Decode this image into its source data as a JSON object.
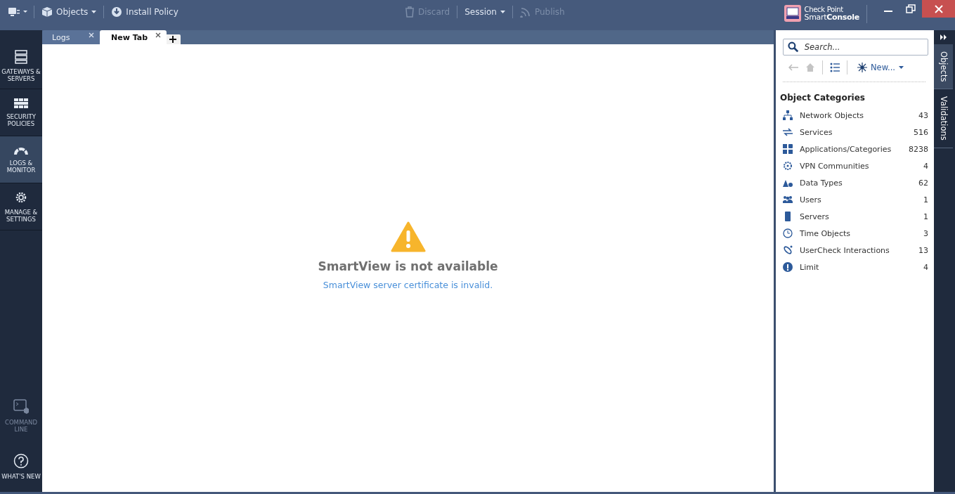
{
  "toolbar": {
    "left": [
      {
        "label": "Objects",
        "dropdown": true,
        "disabled": false
      },
      {
        "label": "Install Policy",
        "dropdown": false,
        "disabled": false
      }
    ],
    "center": [
      {
        "label": "Discard",
        "dropdown": false,
        "disabled": true
      },
      {
        "label": "Session",
        "dropdown": true,
        "disabled": false
      },
      {
        "label": "Publish",
        "dropdown": false,
        "disabled": true
      }
    ],
    "brand": {
      "line1": "Check Point",
      "line2a": "Smart",
      "line2b": "Console"
    }
  },
  "tabs": [
    {
      "label": "Logs",
      "selected": false
    },
    {
      "label": "New Tab",
      "selected": true
    }
  ],
  "nav": [
    {
      "label": "GATEWAYS & SERVERS",
      "selected": false,
      "disabled": false
    },
    {
      "label": "SECURITY POLICIES",
      "selected": false,
      "disabled": false
    },
    {
      "label": "LOGS & MONITOR",
      "selected": true,
      "disabled": false
    },
    {
      "label": "MANAGE & SETTINGS",
      "selected": false,
      "disabled": false
    }
  ],
  "nav_bottom": [
    {
      "label": "COMMAND LINE",
      "selected": false,
      "disabled": true
    },
    {
      "label": "WHAT'S NEW",
      "selected": false,
      "disabled": false
    }
  ],
  "message": {
    "title": "SmartView is not available",
    "link": "SmartView server certificate is invalid."
  },
  "objects_panel": {
    "search": {
      "placeholder": "Search..."
    },
    "new_label": "New...",
    "heading": "Object Categories",
    "categories": [
      {
        "name": "Network Objects",
        "count": "43"
      },
      {
        "name": "Services",
        "count": "516"
      },
      {
        "name": "Applications/Categories",
        "count": "8238"
      },
      {
        "name": "VPN Communities",
        "count": "4"
      },
      {
        "name": "Data Types",
        "count": "62"
      },
      {
        "name": "Users",
        "count": "1"
      },
      {
        "name": "Servers",
        "count": "1"
      },
      {
        "name": "Time Objects",
        "count": "3"
      },
      {
        "name": "UserCheck Interactions",
        "count": "13"
      },
      {
        "name": "Limit",
        "count": "4"
      }
    ]
  },
  "side_tabs": [
    {
      "label": "Objects",
      "selected": true
    },
    {
      "label": "Validations",
      "selected": false
    }
  ]
}
